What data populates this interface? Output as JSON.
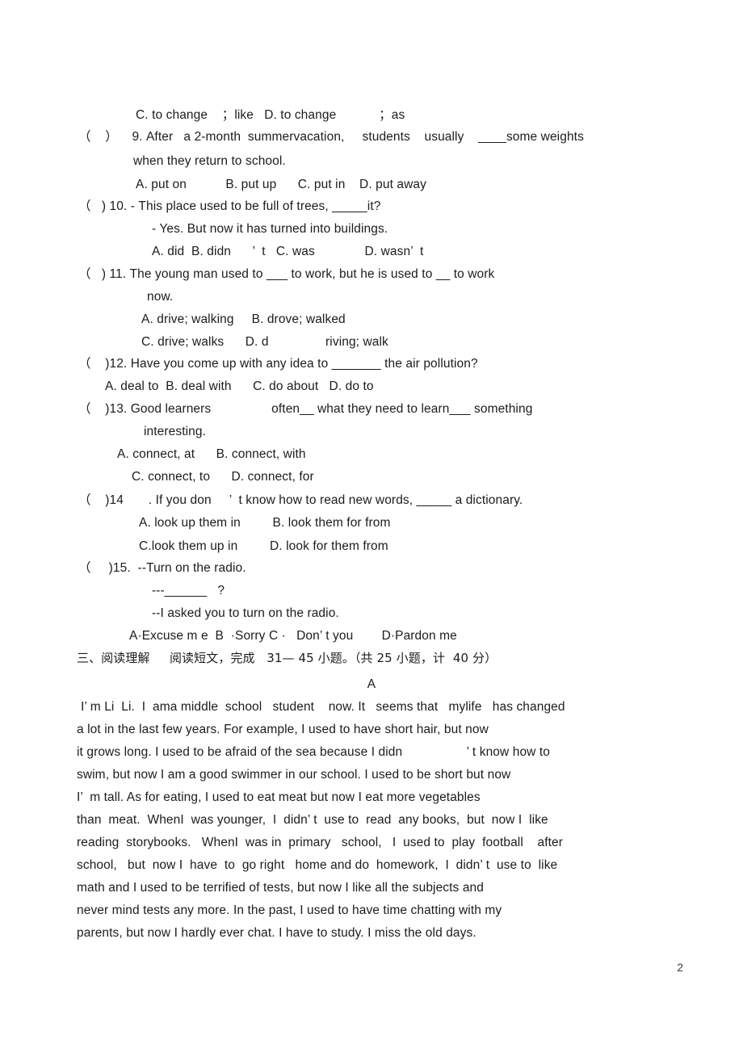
{
  "document": {
    "page_number": "2",
    "background_color": "#ffffff",
    "text_color": "#1c1c1c"
  },
  "questions": [
    {
      "id": "q8-options-tail",
      "lines": [
        "C. to change    ；like   D. to change            ；as"
      ]
    },
    {
      "id": "q9",
      "marker": "（    ）",
      "number": "9.",
      "lines": [
        "（    ）    9. After   a 2-month  summervacation,     students    usually    ____some weights",
        "when they return to school."
      ],
      "options": "A. put on           B. put up      C. put in    D. put away"
    },
    {
      "id": "q10",
      "marker": "（    ）",
      "number": "10.",
      "lines": [
        "（   ) 10. - This place used to be full of trees, _____it?",
        "- Yes. But now it has turned into buildings."
      ],
      "options": "A. did  B. didn      ’  t   C. was              D. wasn’  t"
    },
    {
      "id": "q11",
      "marker": "（    ）",
      "number": "11.",
      "lines": [
        "（   ) 11. The young man used to ___ to work, but he is used to __ to work",
        "now."
      ],
      "options_a": "A. drive; walking     B. drove; walked",
      "options_b": "C. drive; walks      D. d                riving; walk"
    },
    {
      "id": "q12",
      "marker": "（    ）",
      "number": "12.",
      "lines": [
        "（    )12. Have you come up with any idea to _______ the air pollution?"
      ],
      "options": "A. deal to  B. deal with      C. do about   D. do to"
    },
    {
      "id": "q13",
      "marker": "（    ）",
      "number": "13.",
      "lines": [
        "（    )13. Good learners                 often__ what they need to learn___ something",
        "interesting."
      ],
      "options_a": "A. connect, at      B. connect, with",
      "options_b": "C. connect, to      D. connect, for"
    },
    {
      "id": "q14",
      "marker": "（    ）",
      "number": "14",
      "lines": [
        "（    )14       . If you don     ’  t know how to read new words, _____ a dictionary."
      ],
      "options_a": "A. look up them in         B. look them for from",
      "options_b": "C.look them up in         D. look for them from"
    },
    {
      "id": "q15",
      "marker": "（    ）",
      "number": "15.",
      "lines": [
        "（     )15.  --Turn on the radio.",
        "---______   ?",
        "--I asked you to turn on the radio."
      ],
      "options": "A·Excuse m e  B  ·Sorry C ·   Don’ t you        D·Pardon me"
    }
  ],
  "section_heading": "三、阅读理解     阅读短文，完成   31— 45 小题。（共 25 小题，计  40 分）",
  "passage": {
    "title": "A",
    "lines": [
      "I’ m Li  Li.  I  ama middle  school   student    now. It   seems that   mylife   has changed",
      "a lot in the last few years. For example, I used to have short hair, but now",
      "it grows long. I used to be afraid of the sea because I didn                  ’ t know how to",
      "swim, but now I am a good swimmer in our school. I used to be short but now",
      "I’  m tall. As for eating, I used to eat meat but now I eat more vegetables",
      "than  meat.  WhenI  was younger,  I  didn’ t  use to  read  any books,  but  now I  like",
      "reading  storybooks.   WhenI  was in  primary   school,   I  used to  play  football    after",
      "school,   but  now I  have  to  go right   home and do  homework,  I  didn’ t  use to  like",
      "math and I used to be terrified of tests, but now I like all the subjects and",
      "never mind tests any more. In the past, I used to have time chatting with my",
      "parents, but now I hardly ever chat. I have to study. I miss the old days."
    ]
  }
}
